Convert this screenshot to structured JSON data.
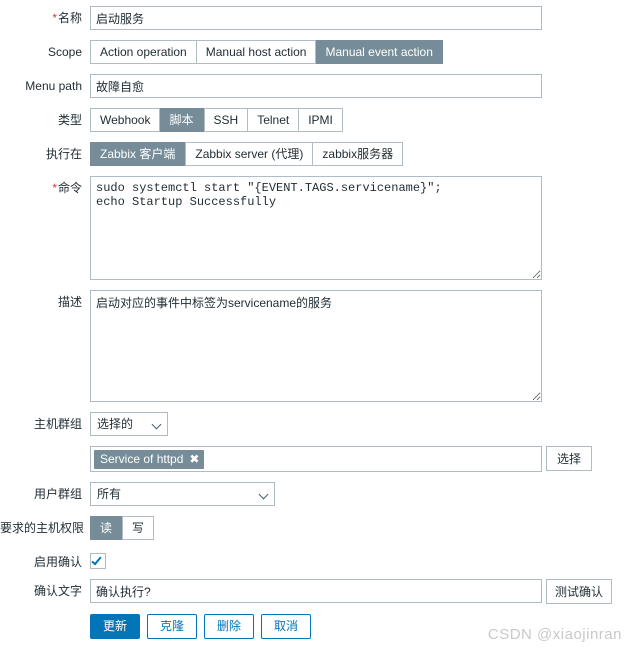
{
  "form": {
    "name": {
      "label": "名称",
      "required": true,
      "value": "启动服务"
    },
    "scope": {
      "label": "Scope",
      "options": [
        "Action operation",
        "Manual host action",
        "Manual event action"
      ],
      "selected": "Manual event action"
    },
    "menu_path": {
      "label": "Menu path",
      "value": "故障自愈"
    },
    "type": {
      "label": "类型",
      "options": [
        "Webhook",
        "脚本",
        "SSH",
        "Telnet",
        "IPMI"
      ],
      "selected": "脚本"
    },
    "execute_on": {
      "label": "执行在",
      "options": [
        "Zabbix 客户端",
        "Zabbix server (代理)",
        "zabbix服务器"
      ],
      "selected": "Zabbix 客户端"
    },
    "command": {
      "label": "命令",
      "required": true,
      "value": "sudo systemctl start \"{EVENT.TAGS.servicename}\";\necho Startup Successfully"
    },
    "description": {
      "label": "描述",
      "value": "启动对应的事件中标签为servicename的服务"
    },
    "host_group": {
      "label": "主机群组",
      "mode_selected": "选择的",
      "chip": "Service of httpd",
      "chip_remove_icon": "✖",
      "select_button": "选择"
    },
    "user_group": {
      "label": "用户群组",
      "selected": "所有"
    },
    "host_permission": {
      "label": "要求的主机权限",
      "options": [
        "读",
        "写"
      ],
      "selected": "读"
    },
    "enable_confirmation": {
      "label": "启用确认",
      "checked": true
    },
    "confirmation_text": {
      "label": "确认文字",
      "value": "确认执行?",
      "test_button": "测试确认"
    },
    "actions": {
      "update": "更新",
      "clone": "克隆",
      "delete": "删除",
      "cancel": "取消"
    }
  },
  "watermark": "CSDN @xiaojinran",
  "colors": {
    "accent_blue": "#0275b8",
    "selected_gray": "#768d99",
    "border": "#b0bcc4",
    "required_red": "#d03b3b"
  }
}
